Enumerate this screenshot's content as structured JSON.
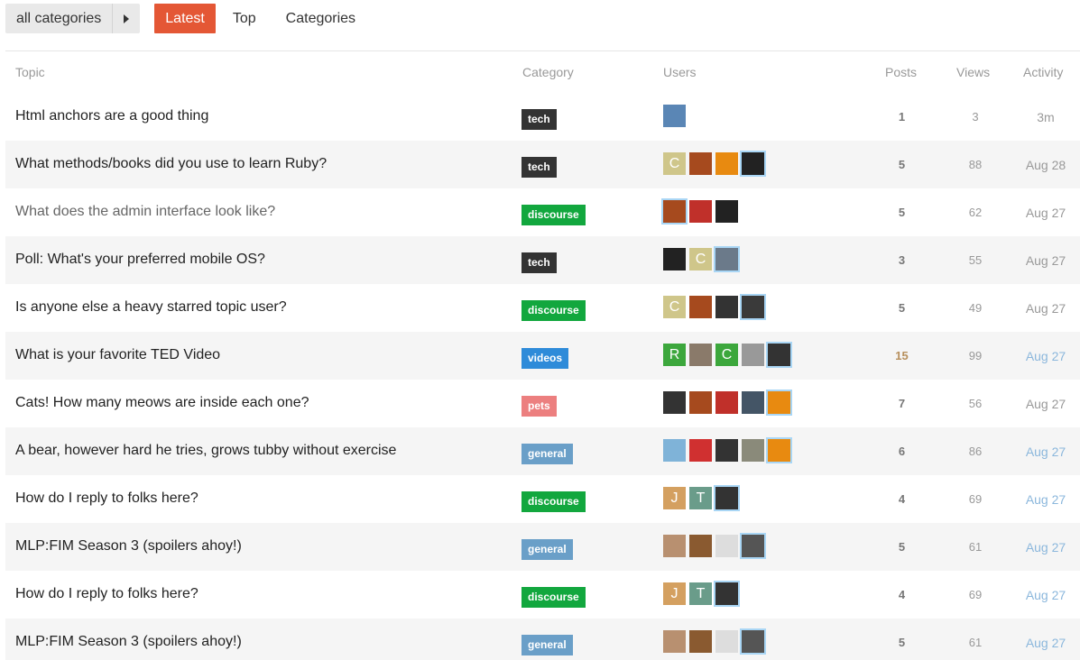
{
  "nav": {
    "category_selector": "all categories",
    "latest": "Latest",
    "top": "Top",
    "categories": "Categories"
  },
  "columns": {
    "topic": "Topic",
    "category": "Category",
    "users": "Users",
    "posts": "Posts",
    "views": "Views",
    "activity": "Activity"
  },
  "category_colors": {
    "tech": "#333333",
    "discourse": "#12a73e",
    "videos": "#2e8bd9",
    "pets": "#ec7f7f",
    "general": "#6a9fc8"
  },
  "topics": [
    {
      "title": "Html anchors are a good thing",
      "category": "tech",
      "posts": "1",
      "views": "3",
      "activity": "3m",
      "users": [
        {
          "icon": "lighthouse-avatar",
          "color": "#5a86b5"
        }
      ]
    },
    {
      "title": "What methods/books did you use to learn Ruby?",
      "category": "tech",
      "posts": "5",
      "views": "88",
      "activity": "Aug 28",
      "users": [
        {
          "letter": "C",
          "color": "#cfc68a"
        },
        {
          "icon": "photo-avatar",
          "color": "#a64a1e"
        },
        {
          "icon": "orange-gem-avatar",
          "color": "#e88a10"
        },
        {
          "icon": "dark-creature-avatar",
          "color": "#222222",
          "highlight": true
        }
      ]
    },
    {
      "title": "What does the admin interface look like?",
      "category": "discourse",
      "posts": "5",
      "views": "62",
      "activity": "Aug 27",
      "visited": true,
      "users": [
        {
          "icon": "photo-avatar",
          "color": "#a64a1e",
          "highlight": true
        },
        {
          "icon": "red-gem-avatar",
          "color": "#c0302a"
        },
        {
          "icon": "dark-creature-avatar",
          "color": "#222222"
        }
      ]
    },
    {
      "title": "Poll: What's your preferred mobile OS?",
      "category": "tech",
      "posts": "3",
      "views": "55",
      "activity": "Aug 27",
      "users": [
        {
          "icon": "bird-avatar",
          "color": "#222222"
        },
        {
          "letter": "C",
          "color": "#cfc68a"
        },
        {
          "icon": "portrait-avatar",
          "color": "#6b7a8a",
          "highlight": true
        }
      ]
    },
    {
      "title": "Is anyone else a heavy starred topic user?",
      "category": "discourse",
      "posts": "5",
      "views": "49",
      "activity": "Aug 27",
      "users": [
        {
          "letter": "C",
          "color": "#cfc68a"
        },
        {
          "icon": "photo-avatar",
          "color": "#a64a1e"
        },
        {
          "icon": "cartoon-face-avatar",
          "color": "#333333"
        },
        {
          "icon": "portrait-avatar",
          "color": "#3a3a3a",
          "highlight": true
        }
      ]
    },
    {
      "title": "What is your favorite TED Video",
      "category": "videos",
      "posts": "15",
      "views": "99",
      "activity": "Aug 27",
      "hot": true,
      "recent": true,
      "users": [
        {
          "letter": "R",
          "color": "#3ca73c"
        },
        {
          "icon": "photo-avatar",
          "color": "#8a7a6a"
        },
        {
          "letter": "C",
          "color": "#3ca73c"
        },
        {
          "icon": "sketch-face-avatar",
          "color": "#999999"
        },
        {
          "icon": "portrait-avatar",
          "color": "#333333",
          "highlight": true
        }
      ]
    },
    {
      "title": "Cats! How many meows are inside each one?",
      "category": "pets",
      "posts": "7",
      "views": "56",
      "activity": "Aug 27",
      "users": [
        {
          "icon": "portrait-avatar",
          "color": "#333333"
        },
        {
          "icon": "photo-avatar",
          "color": "#a64a1e"
        },
        {
          "icon": "red-gem-avatar",
          "color": "#c0302a"
        },
        {
          "icon": "portrait-avatar",
          "color": "#445566"
        },
        {
          "icon": "orange-gem-avatar",
          "color": "#e88a10",
          "highlight": true
        }
      ]
    },
    {
      "title": "A bear, however hard he tries, grows tubby without exercise",
      "category": "general",
      "posts": "6",
      "views": "86",
      "activity": "Aug 27",
      "recent": true,
      "users": [
        {
          "icon": "bottle-avatar",
          "color": "#7fb3d8"
        },
        {
          "icon": "logo-avatar",
          "color": "#d03030"
        },
        {
          "icon": "cartoon-face-avatar",
          "color": "#333333"
        },
        {
          "icon": "photo-avatar",
          "color": "#8a8a7a"
        },
        {
          "icon": "orange-gem-avatar",
          "color": "#e88a10",
          "highlight": true
        }
      ]
    },
    {
      "title": "How do I reply to folks here?",
      "category": "discourse",
      "posts": "4",
      "views": "69",
      "activity": "Aug 27",
      "recent": true,
      "users": [
        {
          "letter": "J",
          "color": "#d4a060"
        },
        {
          "letter": "T",
          "color": "#6a9c8a"
        },
        {
          "icon": "cartoon-face-avatar",
          "color": "#333333",
          "highlight": true
        }
      ]
    },
    {
      "title": "MLP:FIM Season 3 (spoilers ahoy!)",
      "category": "general",
      "posts": "5",
      "views": "61",
      "activity": "Aug 27",
      "recent": true,
      "users": [
        {
          "icon": "photo-avatar",
          "color": "#b89070"
        },
        {
          "icon": "bear-avatar",
          "color": "#8a5a30"
        },
        {
          "icon": "rfm-logo-avatar",
          "color": "#dddddd"
        },
        {
          "icon": "portrait-avatar",
          "color": "#555555",
          "highlight": true
        }
      ]
    },
    {
      "title": "How do I reply to folks here?",
      "category": "discourse",
      "posts": "4",
      "views": "69",
      "activity": "Aug 27",
      "recent": true,
      "users": [
        {
          "letter": "J",
          "color": "#d4a060"
        },
        {
          "letter": "T",
          "color": "#6a9c8a"
        },
        {
          "icon": "cartoon-face-avatar",
          "color": "#333333",
          "highlight": true
        }
      ]
    },
    {
      "title": "MLP:FIM Season 3 (spoilers ahoy!)",
      "category": "general",
      "posts": "5",
      "views": "61",
      "activity": "Aug 27",
      "recent": true,
      "users": [
        {
          "icon": "photo-avatar",
          "color": "#b89070"
        },
        {
          "icon": "bear-avatar",
          "color": "#8a5a30"
        },
        {
          "icon": "rfm-logo-avatar",
          "color": "#dddddd"
        },
        {
          "icon": "portrait-avatar",
          "color": "#555555",
          "highlight": true
        }
      ]
    }
  ]
}
